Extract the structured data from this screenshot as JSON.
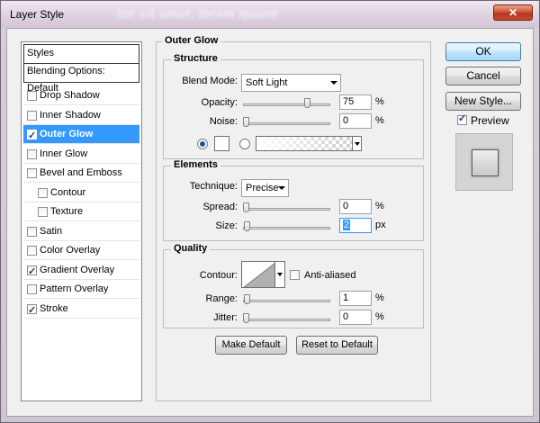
{
  "window": {
    "title": "Layer Style",
    "blur_text": "lor sit amet, lorem ipsum",
    "close_icon": "close-x-icon"
  },
  "styles_panel": {
    "header": "Styles",
    "blending_options": "Blending Options: Default",
    "items": [
      {
        "label": "Drop Shadow",
        "checked": false,
        "selected": false,
        "sub": false
      },
      {
        "label": "Inner Shadow",
        "checked": false,
        "selected": false,
        "sub": false
      },
      {
        "label": "Outer Glow",
        "checked": true,
        "selected": true,
        "sub": false
      },
      {
        "label": "Inner Glow",
        "checked": false,
        "selected": false,
        "sub": false
      },
      {
        "label": "Bevel and Emboss",
        "checked": false,
        "selected": false,
        "sub": false
      },
      {
        "label": "Contour",
        "checked": false,
        "selected": false,
        "sub": true
      },
      {
        "label": "Texture",
        "checked": false,
        "selected": false,
        "sub": true
      },
      {
        "label": "Satin",
        "checked": false,
        "selected": false,
        "sub": false
      },
      {
        "label": "Color Overlay",
        "checked": false,
        "selected": false,
        "sub": false
      },
      {
        "label": "Gradient Overlay",
        "checked": true,
        "selected": false,
        "sub": false
      },
      {
        "label": "Pattern Overlay",
        "checked": false,
        "selected": false,
        "sub": false
      },
      {
        "label": "Stroke",
        "checked": true,
        "selected": false,
        "sub": false
      }
    ]
  },
  "outer_glow": {
    "title": "Outer Glow",
    "structure": {
      "title": "Structure",
      "blend_mode_label": "Blend Mode:",
      "blend_mode_value": "Soft Light",
      "opacity_label": "Opacity:",
      "opacity_value": "75",
      "opacity_unit": "%",
      "opacity_level": 0.75,
      "noise_label": "Noise:",
      "noise_value": "0",
      "noise_unit": "%",
      "noise_level": 0,
      "color_radio_selected": true,
      "gradient_radio_selected": false
    },
    "elements": {
      "title": "Elements",
      "technique_label": "Technique:",
      "technique_value": "Precise",
      "spread_label": "Spread:",
      "spread_value": "0",
      "spread_unit": "%",
      "spread_level": 0,
      "size_label": "Size:",
      "size_value": "2",
      "size_unit": "px",
      "size_level": 0.01
    },
    "quality": {
      "title": "Quality",
      "contour_label": "Contour:",
      "anti_aliased_label": "Anti-aliased",
      "anti_aliased_checked": false,
      "range_label": "Range:",
      "range_value": "1",
      "range_unit": "%",
      "range_level": 0.01,
      "jitter_label": "Jitter:",
      "jitter_value": "0",
      "jitter_unit": "%",
      "jitter_level": 0
    },
    "make_default": "Make Default",
    "reset_to_default": "Reset to Default"
  },
  "buttons": {
    "ok": "OK",
    "cancel": "Cancel",
    "new_style": "New Style...",
    "preview_label": "Preview",
    "preview_checked": true
  },
  "colors": {
    "selection": "#3399ff",
    "title_bar": "#ddd1df",
    "close_button": "#c44a2c"
  }
}
